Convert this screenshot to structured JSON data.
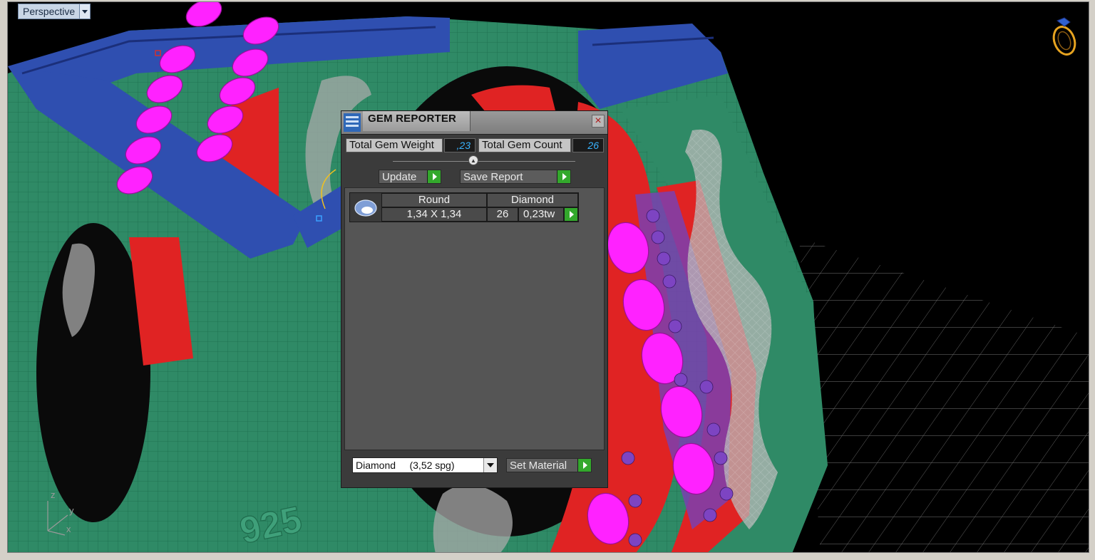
{
  "viewport": {
    "name": "Perspective"
  },
  "axes": {
    "z": "z",
    "y": "y",
    "x": "x"
  },
  "engraving": "925",
  "gem_reporter": {
    "title": "GEM REPORTER",
    "close": "×",
    "total_gem_weight_label": "Total Gem Weight",
    "total_gem_weight_value": ",23",
    "total_gem_count_label": "Total Gem Count",
    "total_gem_count_value": "26",
    "update_label": "Update",
    "save_report_label": "Save Report",
    "gem_rows": [
      {
        "shape": "Round",
        "material": "Diamond",
        "size": "1,34 X 1,34",
        "count": "26",
        "weight": "0,23tw"
      }
    ],
    "material_select": "Diamond     (3,52 spg)",
    "set_material_label": "Set Material"
  }
}
